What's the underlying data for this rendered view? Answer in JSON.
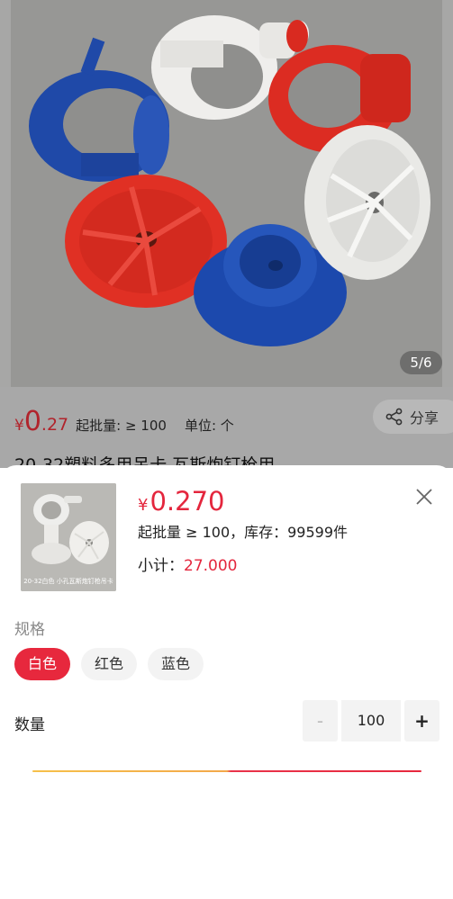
{
  "photo": {
    "page_counter": "5/6"
  },
  "product": {
    "currency": "¥",
    "price_int": "0",
    "price_dec": ".27",
    "min_order": "起批量: ≥ 100",
    "unit": "单位: 个",
    "share_label": "分享",
    "title": "20-32塑料多用吊卡 瓦斯炮钉枪用"
  },
  "sheet": {
    "thumb_caption": "20-32白色 小孔瓦斯炮钉枪吊卡",
    "currency": "¥",
    "price": "0.270",
    "stock_line": "起批量 ≥ 100，库存：99599件",
    "subtotal_label": "小计：",
    "subtotal_value": "27.000",
    "spec_label": "规格",
    "specs": [
      "白色",
      "红色",
      "蓝色"
    ],
    "quantity_label": "数量",
    "quantity_minus": "-",
    "quantity_value": "100",
    "quantity_plus": "+"
  },
  "colors": {
    "accent": "#e7283d",
    "price_red": "#e4263d"
  }
}
